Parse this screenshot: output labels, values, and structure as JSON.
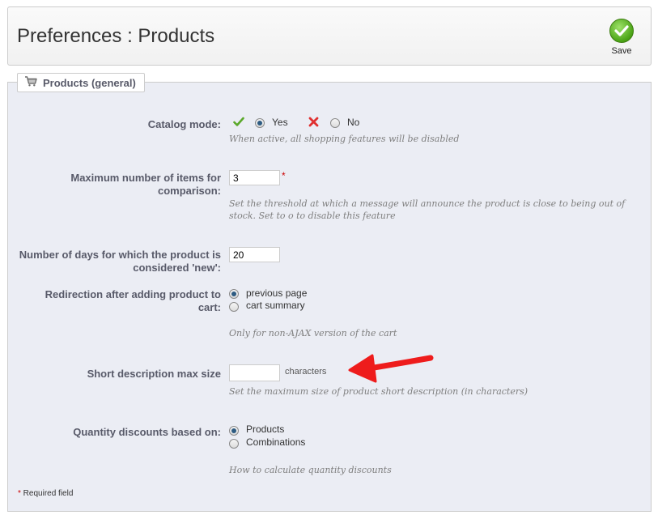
{
  "header": {
    "title": "Preferences : Products",
    "save_label": "Save"
  },
  "section": {
    "legend": "Products (general)"
  },
  "catalog_mode": {
    "label": "Catalog mode:",
    "yes_label": "Yes",
    "no_label": "No",
    "selected": "Yes",
    "help": "When active, all shopping features will be disabled"
  },
  "max_compare": {
    "label": "Maximum number of items for comparison:",
    "value": "3",
    "required_mark": "*",
    "help": "Set the threshold at which a message will announce the product is close to being out of stock. Set to o to disable this feature"
  },
  "new_days": {
    "label": "Number of days for which the product is considered 'new':",
    "value": "20"
  },
  "redirection": {
    "label": "Redirection after adding product to cart:",
    "option1": "previous page",
    "option2": "cart summary",
    "selected": "previous page",
    "help": "Only for non-AJAX version of the cart"
  },
  "short_desc": {
    "label": "Short description max size",
    "value": "",
    "unit": "characters",
    "help": "Set the maximum size of product short description (in characters)"
  },
  "qty_discounts": {
    "label": "Quantity discounts based on:",
    "option1": "Products",
    "option2": "Combinations",
    "selected": "Products",
    "help": "How to calculate quantity discounts"
  },
  "footer": {
    "required_note": "* Required field"
  },
  "colors": {
    "accent_red": "#ee1c1c",
    "check_green": "#4aa315",
    "label": "#585a69"
  }
}
